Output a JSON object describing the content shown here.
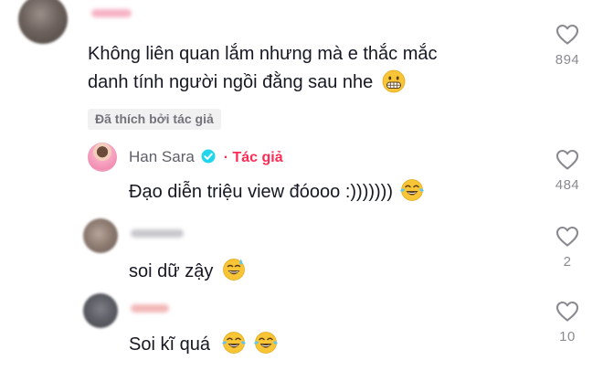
{
  "comment1": {
    "line1": "Không liên quan lắm nhưng mà e thắc mắc",
    "line2": "danh tính người ngồi đằng sau nhe",
    "liked_badge": "Đã thích bởi tác giả",
    "like_count": "894",
    "emoji": "grimacing-face"
  },
  "reply_author": {
    "name": "Han Sara",
    "tag": "· Tác giả",
    "text": "Đạo diễn triệu view đóooo :)))))))",
    "like_count": "484",
    "emoji": "tears-of-joy",
    "verified_color": "#20d5ec"
  },
  "reply2": {
    "text": "soi dữ zậy",
    "like_count": "2",
    "emoji": "grinning-sweat"
  },
  "reply3": {
    "text": "Soi kĩ quá",
    "like_count": "10",
    "emoji": "tears-of-joy"
  },
  "colors": {
    "author_accent": "#fe2c55",
    "text": "#161823",
    "muted": "#8a8b91"
  }
}
